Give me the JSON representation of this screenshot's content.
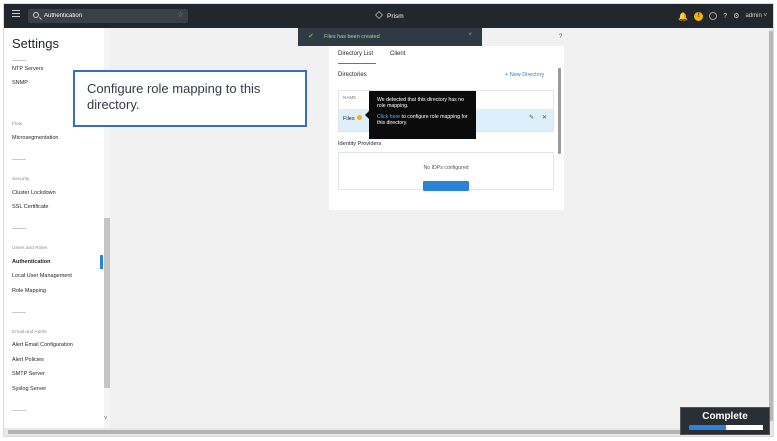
{
  "topbar": {
    "search_value": "Authentication",
    "brand": "Prism",
    "warning_count": "!",
    "help": "?",
    "user": "admin",
    "user_caret": "˅"
  },
  "sidebar": {
    "title": "Settings",
    "groups": [
      {
        "label": "",
        "items": [
          "NTP Servers",
          "SNMP"
        ]
      },
      {
        "label": "Flow",
        "items": [
          "Microsegmentation"
        ]
      },
      {
        "label": "Security",
        "items": [
          "Cluster Lockdown",
          "SSL Certificate"
        ]
      },
      {
        "label": "Users and Roles",
        "items": [
          "Authentication",
          "Local User Management",
          "Role Mapping"
        ]
      },
      {
        "label": "Email and Alerts",
        "items": [
          "Alert Email Configuration",
          "Alert Policies",
          "SMTP Server",
          "Syslog Server"
        ]
      }
    ],
    "active_item": "Authentication"
  },
  "toast": {
    "message": "Files has been created",
    "close": "×"
  },
  "help_icon": "?",
  "auth": {
    "tabs": [
      "Directory List",
      "Client"
    ],
    "directories_label": "Directories",
    "new_directory": "+ New Directory",
    "table_header": "NAME",
    "directory_name": "Files",
    "identity_providers_label": "Identity Providers",
    "no_idps": "No IDPs configured"
  },
  "tooltip": {
    "line1": "We detected that this directory has no role mapping.",
    "link": "Click here",
    "line2": " to configure role mapping for this directory."
  },
  "callout": {
    "text": "Configure role mapping to this directory."
  },
  "progress": {
    "label": "Complete",
    "fraction": 0.5
  },
  "colors": {
    "accent": "#2a83d6",
    "topbar": "#22272e",
    "warning": "#f5b400",
    "success": "#4cbb6a"
  }
}
